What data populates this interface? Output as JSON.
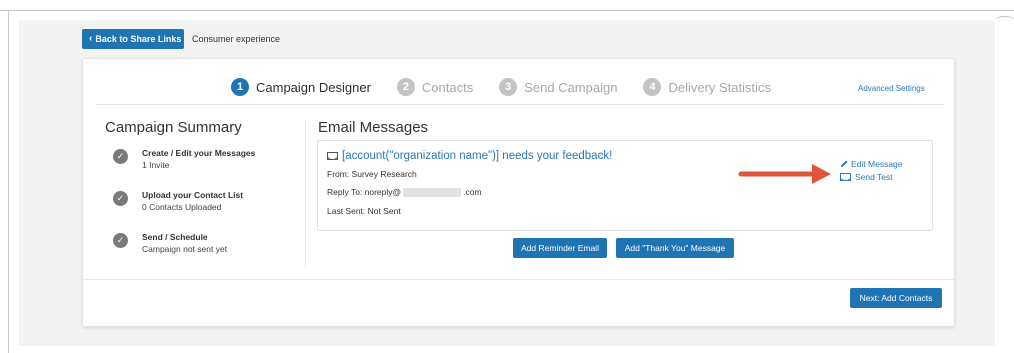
{
  "header": {
    "back_label": "Back to Share Links",
    "breadcrumb": "Consumer experience"
  },
  "steps": [
    {
      "num": "1",
      "label": "Campaign Designer"
    },
    {
      "num": "2",
      "label": "Contacts"
    },
    {
      "num": "3",
      "label": "Send Campaign"
    },
    {
      "num": "4",
      "label": "Delivery Statistics"
    }
  ],
  "advanced_settings": "Advanced Settings",
  "summary": {
    "title": "Campaign Summary",
    "items": [
      {
        "title": "Create / Edit your Messages",
        "detail": "1 Invite"
      },
      {
        "title": "Upload your Contact List",
        "detail": "0 Contacts Uploaded"
      },
      {
        "title": "Send / Schedule",
        "detail": "Campaign not sent yet"
      }
    ]
  },
  "email": {
    "title": "Email Messages",
    "subject": "[account(\"organization name\")] needs your feedback!",
    "from": "From: Survey Research",
    "reply_prefix": "Reply To: noreply@",
    "reply_suffix": ".com",
    "last_sent": "Last Sent: Not Sent",
    "edit_label": "Edit Message",
    "test_label": "Send Test"
  },
  "buttons": {
    "reminder": "Add Reminder Email",
    "thank_you": "Add \"Thank You\" Message",
    "next": "Next: Add Contacts"
  },
  "colors": {
    "primary": "#1f75b4",
    "link": "#2a77b8",
    "arrow": "#e0543c"
  },
  "icons": {
    "back": "chevron-left-icon",
    "check": "check-circle-icon",
    "envelope": "envelope-icon",
    "pencil": "pencil-icon",
    "annotation": "red-arrow-icon"
  }
}
